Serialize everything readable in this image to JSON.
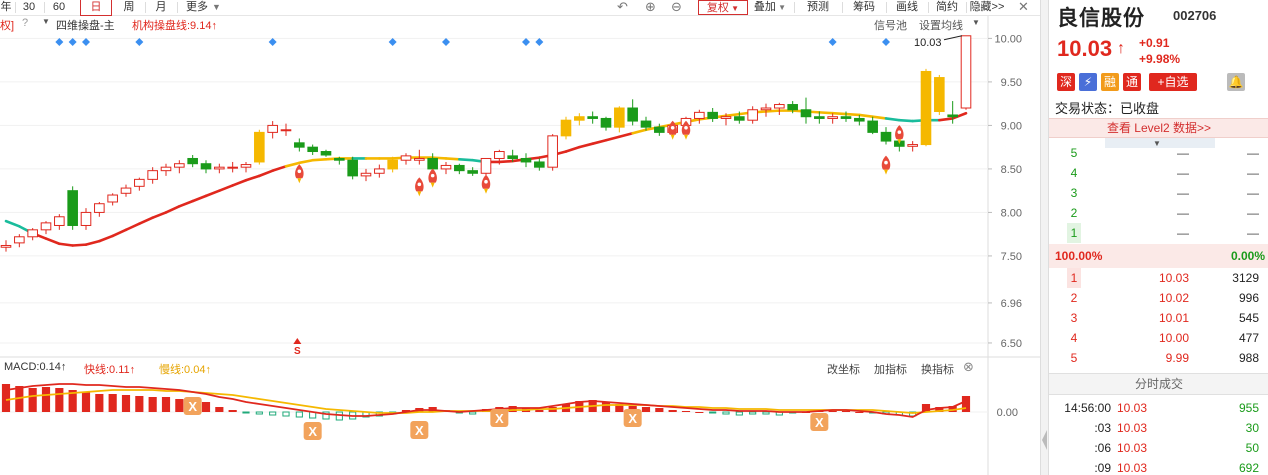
{
  "toolbar": {
    "left_fragment": "",
    "periods": [
      "年",
      "30",
      "60",
      "日",
      "周",
      "月",
      "更多"
    ],
    "active_period": "日",
    "more_label": "更多",
    "right_buttons": {
      "fuquan": "复权",
      "diejia": "叠加",
      "yuce": "预测",
      "chouma": "筹码",
      "huaxian": "画线",
      "jianyue": "简约",
      "yincang": "隐藏>>"
    }
  },
  "legend": {
    "left_edge": "权]",
    "indicator_name": "四维操盘-主",
    "inst_line_label": "机构操盘线:9.14",
    "signal_pool": "信号池",
    "set_ma": "设置均线"
  },
  "macd": {
    "macd_label": "MACD:0.14",
    "fast_label": "快线:0.11",
    "slow_label": "慢线:0.04",
    "buttons": {
      "change_coord": "改坐标",
      "add_indicator": "加指标",
      "swap_indicator": "换指标"
    },
    "zero_label": "0.00"
  },
  "chart_data": {
    "type": "candlestick",
    "title": "",
    "y_axis_ticks": [
      "10.00",
      "9.50",
      "9.00",
      "8.50",
      "8.00",
      "7.50",
      "6.96",
      "6.50"
    ],
    "y_range": [
      6.35,
      10.2
    ],
    "last_close_callout": "10.03",
    "s_marker": "S",
    "candles": [
      [
        7.6,
        7.68,
        7.55,
        7.62
      ],
      [
        7.65,
        7.75,
        7.6,
        7.72
      ],
      [
        7.72,
        7.82,
        7.68,
        7.8
      ],
      [
        7.8,
        7.9,
        7.75,
        7.88
      ],
      [
        7.85,
        7.98,
        7.8,
        7.95
      ],
      [
        8.25,
        8.3,
        7.8,
        7.85
      ],
      [
        7.85,
        8.05,
        7.8,
        8.0
      ],
      [
        8.0,
        8.12,
        7.95,
        8.1
      ],
      [
        8.12,
        8.22,
        8.08,
        8.2
      ],
      [
        8.22,
        8.32,
        8.18,
        8.28
      ],
      [
        8.3,
        8.4,
        8.25,
        8.38
      ],
      [
        8.38,
        8.52,
        8.33,
        8.48
      ],
      [
        8.48,
        8.56,
        8.42,
        8.52
      ],
      [
        8.52,
        8.6,
        8.45,
        8.56
      ],
      [
        8.62,
        8.66,
        8.52,
        8.56
      ],
      [
        8.56,
        8.6,
        8.45,
        8.5
      ],
      [
        8.5,
        8.56,
        8.45,
        8.52
      ],
      [
        8.52,
        8.58,
        8.46,
        8.52
      ],
      [
        8.52,
        8.58,
        8.46,
        8.55
      ],
      [
        8.58,
        8.95,
        8.55,
        8.92
      ],
      [
        8.92,
        9.05,
        8.85,
        9.0
      ],
      [
        8.95,
        9.02,
        8.88,
        8.95
      ],
      [
        8.8,
        8.85,
        8.7,
        8.75
      ],
      [
        8.75,
        8.78,
        8.66,
        8.7
      ],
      [
        8.7,
        8.72,
        8.64,
        8.66
      ],
      [
        8.62,
        8.64,
        8.55,
        8.6
      ],
      [
        8.6,
        8.64,
        8.38,
        8.42
      ],
      [
        8.42,
        8.5,
        8.36,
        8.45
      ],
      [
        8.45,
        8.55,
        8.4,
        8.5
      ],
      [
        8.5,
        8.64,
        8.46,
        8.6
      ],
      [
        8.6,
        8.68,
        8.55,
        8.65
      ],
      [
        8.6,
        8.72,
        8.55,
        8.62
      ],
      [
        8.62,
        8.68,
        8.45,
        8.5
      ],
      [
        8.5,
        8.58,
        8.44,
        8.54
      ],
      [
        8.54,
        8.56,
        8.44,
        8.48
      ],
      [
        8.48,
        8.52,
        8.42,
        8.45
      ],
      [
        8.45,
        8.6,
        8.4,
        8.62
      ],
      [
        8.62,
        8.72,
        8.55,
        8.7
      ],
      [
        8.65,
        8.72,
        8.58,
        8.62
      ],
      [
        8.62,
        8.68,
        8.52,
        8.58
      ],
      [
        8.58,
        8.62,
        8.48,
        8.52
      ],
      [
        8.52,
        8.9,
        8.48,
        8.88
      ],
      [
        8.88,
        9.1,
        8.84,
        9.06
      ],
      [
        9.06,
        9.14,
        9.0,
        9.1
      ],
      [
        9.1,
        9.16,
        9.02,
        9.08
      ],
      [
        9.08,
        9.1,
        8.94,
        8.98
      ],
      [
        8.98,
        9.22,
        8.92,
        9.2
      ],
      [
        9.2,
        9.3,
        9.0,
        9.05
      ],
      [
        9.05,
        9.1,
        8.94,
        8.98
      ],
      [
        8.98,
        9.02,
        8.88,
        8.92
      ],
      [
        8.92,
        9.02,
        8.86,
        9.0
      ],
      [
        9.0,
        9.1,
        8.98,
        9.08
      ],
      [
        9.08,
        9.18,
        9.02,
        9.15
      ],
      [
        9.15,
        9.2,
        9.04,
        9.08
      ],
      [
        9.08,
        9.14,
        9.0,
        9.1
      ],
      [
        9.1,
        9.16,
        9.02,
        9.06
      ],
      [
        9.06,
        9.22,
        9.02,
        9.18
      ],
      [
        9.18,
        9.25,
        9.1,
        9.2
      ],
      [
        9.2,
        9.26,
        9.12,
        9.24
      ],
      [
        9.24,
        9.28,
        9.14,
        9.18
      ],
      [
        9.18,
        9.32,
        9.02,
        9.1
      ],
      [
        9.1,
        9.16,
        9.02,
        9.08
      ],
      [
        9.08,
        9.14,
        9.02,
        9.1
      ],
      [
        9.1,
        9.16,
        9.04,
        9.08
      ],
      [
        9.08,
        9.12,
        9.0,
        9.05
      ],
      [
        9.05,
        9.1,
        8.9,
        8.92
      ],
      [
        8.92,
        8.98,
        8.78,
        8.82
      ],
      [
        8.82,
        8.9,
        8.7,
        8.76
      ],
      [
        8.76,
        8.82,
        8.7,
        8.78
      ],
      [
        8.78,
        9.65,
        8.76,
        9.62
      ],
      [
        9.55,
        9.58,
        9.12,
        9.16
      ],
      [
        9.12,
        9.28,
        9.02,
        9.1
      ],
      [
        9.2,
        10.03,
        9.18,
        10.03
      ]
    ],
    "yellow_bars": [
      19,
      29,
      42,
      43,
      46,
      69,
      70
    ],
    "ma_inst": [
      7.9,
      7.84,
      7.76,
      7.7,
      7.64,
      7.62,
      7.63,
      7.67,
      7.73,
      7.8,
      7.87,
      7.94,
      8.0,
      8.07,
      8.13,
      8.19,
      8.25,
      8.31,
      8.37,
      8.42,
      8.48,
      8.53,
      8.57,
      8.6,
      8.61,
      8.62,
      8.62,
      8.62,
      8.62,
      8.62,
      8.63,
      8.63,
      8.63,
      8.62,
      8.61,
      8.6,
      8.58,
      8.58,
      8.59,
      8.61,
      8.63,
      8.66,
      8.7,
      8.75,
      8.79,
      8.83,
      8.87,
      8.91,
      8.95,
      8.98,
      9.01,
      9.04,
      9.07,
      9.09,
      9.11,
      9.13,
      9.15,
      9.16,
      9.17,
      9.17,
      9.16,
      9.15,
      9.14,
      9.13,
      9.12,
      9.1,
      9.08,
      9.06,
      9.05,
      9.06,
      9.06,
      9.08,
      9.14
    ],
    "ma_colors": [
      "teal",
      "teal",
      "red",
      "red",
      "red",
      "red",
      "red",
      "red",
      "red",
      "red",
      "red",
      "red",
      "red",
      "red",
      "red",
      "red",
      "red",
      "red",
      "red",
      "red",
      "red",
      "yellow",
      "yellow",
      "yellow",
      "yellow",
      "yellow",
      "teal",
      "yellow",
      "yellow",
      "yellow",
      "yellow",
      "yellow",
      "yellow",
      "yellow",
      "teal",
      "teal",
      "red",
      "red",
      "red",
      "red",
      "red",
      "red",
      "red",
      "red",
      "red",
      "red",
      "red",
      "yellow",
      "yellow",
      "yellow",
      "yellow",
      "yellow",
      "yellow",
      "yellow",
      "yellow",
      "yellow",
      "yellow",
      "yellow",
      "yellow",
      "yellow",
      "yellow",
      "yellow",
      "yellow",
      "yellow",
      "yellow",
      "yellow",
      "teal",
      "teal",
      "teal",
      "teal",
      "red",
      "red",
      "red"
    ],
    "rocket_markers": [
      {
        "i": 22,
        "p": 8.45
      },
      {
        "i": 31,
        "p": 8.3
      },
      {
        "i": 32,
        "p": 8.4
      },
      {
        "i": 36,
        "p": 8.33
      },
      {
        "i": 50,
        "p": 8.95
      },
      {
        "i": 51,
        "p": 8.95
      },
      {
        "i": 66,
        "p": 8.55
      },
      {
        "i": 67,
        "p": 8.9
      }
    ],
    "diamonds": [
      4,
      5,
      6,
      10,
      20,
      29,
      33,
      39,
      40,
      62,
      66
    ],
    "macd_hist": [
      0.28,
      0.26,
      0.24,
      0.25,
      0.24,
      0.22,
      0.2,
      0.18,
      0.18,
      0.17,
      0.16,
      0.15,
      0.15,
      0.13,
      0.12,
      0.1,
      0.05,
      0.02,
      -0.01,
      -0.02,
      -0.03,
      -0.04,
      -0.05,
      -0.06,
      -0.07,
      -0.08,
      -0.07,
      -0.05,
      -0.04,
      -0.02,
      0.02,
      0.04,
      0.05,
      0.02,
      -0.01,
      -0.02,
      0.03,
      0.05,
      0.06,
      0.04,
      0.02,
      0.05,
      0.08,
      0.11,
      0.12,
      0.1,
      0.08,
      0.06,
      0.05,
      0.04,
      0.02,
      0.01,
      0.0,
      -0.01,
      -0.02,
      -0.03,
      -0.02,
      -0.02,
      -0.03,
      -0.01,
      0.0,
      0.01,
      0.01,
      0.01,
      0.0,
      -0.01,
      -0.02,
      -0.03,
      -0.04,
      0.08,
      0.05,
      0.06,
      0.16
    ],
    "macd_fast": [
      0.22,
      0.24,
      0.26,
      0.27,
      0.28,
      0.28,
      0.27,
      0.27,
      0.26,
      0.25,
      0.25,
      0.24,
      0.23,
      0.22,
      0.2,
      0.18,
      0.15,
      0.13,
      0.1,
      0.08,
      0.06,
      0.04,
      0.02,
      0.0,
      -0.02,
      -0.03,
      -0.04,
      -0.04,
      -0.03,
      -0.02,
      0.0,
      0.02,
      0.02,
      0.01,
      0.0,
      0.01,
      0.02,
      0.03,
      0.04,
      0.04,
      0.04,
      0.06,
      0.08,
      0.1,
      0.11,
      0.1,
      0.09,
      0.08,
      0.07,
      0.06,
      0.05,
      0.04,
      0.03,
      0.02,
      0.02,
      0.01,
      0.01,
      0.01,
      0.0,
      0.0,
      0.0,
      0.01,
      0.02,
      0.02,
      0.01,
      0.0,
      -0.02,
      -0.03,
      -0.05,
      0.02,
      0.04,
      0.05,
      0.11
    ],
    "macd_slow": [
      0.12,
      0.14,
      0.16,
      0.17,
      0.18,
      0.19,
      0.2,
      0.21,
      0.22,
      0.22,
      0.22,
      0.22,
      0.21,
      0.21,
      0.2,
      0.19,
      0.18,
      0.17,
      0.15,
      0.13,
      0.11,
      0.09,
      0.07,
      0.05,
      0.03,
      0.02,
      0.01,
      0.0,
      -0.01,
      -0.01,
      -0.01,
      0.0,
      0.0,
      0.01,
      0.01,
      0.01,
      0.01,
      0.01,
      0.02,
      0.02,
      0.03,
      0.03,
      0.04,
      0.05,
      0.06,
      0.07,
      0.07,
      0.07,
      0.07,
      0.06,
      0.06,
      0.05,
      0.05,
      0.04,
      0.04,
      0.03,
      0.03,
      0.03,
      0.02,
      0.02,
      0.02,
      0.02,
      0.02,
      0.02,
      0.02,
      0.02,
      0.01,
      0.0,
      -0.01,
      0.0,
      0.01,
      0.02,
      0.04
    ],
    "x_markers": [
      14,
      23,
      31,
      37,
      47,
      61
    ],
    "x_markers_low": [
      22,
      46,
      58
    ],
    "x_marker_label": "X"
  },
  "quote": {
    "name": "良信股份",
    "code": "002706",
    "price": "10.03",
    "change": "+0.91",
    "change_pct": "+9.98%",
    "tags": [
      "深",
      "融",
      "通",
      "+自选"
    ],
    "state": "交易状态：已收盘",
    "level2": "查看 Level2 数据>>",
    "asks": [
      {
        "lv": "5",
        "price": "—",
        "vol": "—"
      },
      {
        "lv": "4",
        "price": "—",
        "vol": "—"
      },
      {
        "lv": "3",
        "price": "—",
        "vol": "—"
      },
      {
        "lv": "2",
        "price": "—",
        "vol": "—"
      },
      {
        "lv": "1",
        "price": "—",
        "vol": "—"
      }
    ],
    "ratio_left": "100.00%",
    "ratio_right": "0.00%",
    "bids": [
      {
        "lv": "1",
        "price": "10.03",
        "vol": "3129"
      },
      {
        "lv": "2",
        "price": "10.02",
        "vol": "996"
      },
      {
        "lv": "3",
        "price": "10.01",
        "vol": "545"
      },
      {
        "lv": "4",
        "price": "10.00",
        "vol": "477"
      },
      {
        "lv": "5",
        "price": "9.99",
        "vol": "988"
      }
    ],
    "tick_header": "分时成交",
    "ticks": [
      {
        "t": "14:56:00",
        "p": "10.03",
        "v": "955"
      },
      {
        "t": ":03",
        "p": "10.03",
        "v": "30"
      },
      {
        "t": ":06",
        "p": "10.03",
        "v": "50"
      },
      {
        "t": ":09",
        "p": "10.03",
        "v": "692"
      }
    ]
  },
  "colors": {
    "up": "#e0281e",
    "down": "#1a9b1a",
    "yellow": "#f5b800",
    "ma_red": "#e0281e",
    "ma_teal": "#1abc9c",
    "macd_slow": "#f5b800",
    "macd_fast": "#e0281e"
  }
}
